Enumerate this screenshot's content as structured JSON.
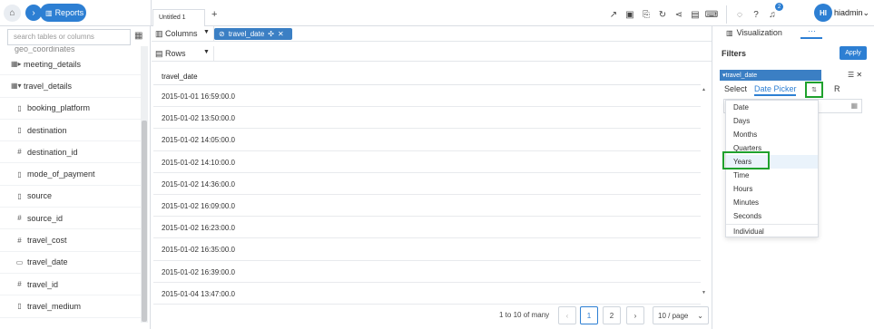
{
  "topbar": {
    "reports_label": "Reports",
    "tab_title": "Untitled 1",
    "tab_add": "+",
    "notifications_count": "2",
    "avatar_initials": "HI",
    "username": "hiadmin"
  },
  "sidebar": {
    "search_placeholder": "search tables or columns",
    "items": [
      {
        "label": "meeting_details",
        "type": "table"
      },
      {
        "label": "travel_details",
        "type": "table"
      },
      {
        "label": "booking_platform",
        "type": "text"
      },
      {
        "label": "destination",
        "type": "text"
      },
      {
        "label": "destination_id",
        "type": "number"
      },
      {
        "label": "mode_of_payment",
        "type": "text"
      },
      {
        "label": "source",
        "type": "text"
      },
      {
        "label": "source_id",
        "type": "number"
      },
      {
        "label": "travel_cost",
        "type": "number"
      },
      {
        "label": "travel_date",
        "type": "date"
      },
      {
        "label": "travel_id",
        "type": "number"
      },
      {
        "label": "travel_medium",
        "type": "text"
      }
    ]
  },
  "shelves": {
    "columns_label": "Columns",
    "rows_label": "Rows",
    "column_chip": "travel_date"
  },
  "grid": {
    "header": "travel_date",
    "rows": [
      "2015-01-01 16:59:00.0",
      "2015-01-02 13:50:00.0",
      "2015-01-02 14:05:00.0",
      "2015-01-02 14:10:00.0",
      "2015-01-02 14:36:00.0",
      "2015-01-02 16:09:00.0",
      "2015-01-02 16:23:00.0",
      "2015-01-02 16:35:00.0",
      "2015-01-02 16:39:00.0",
      "2015-01-04 13:47:00.0"
    ]
  },
  "pagination": {
    "summary": "1 to 10 of many",
    "page_1": "1",
    "page_2": "2",
    "page_size": "10 / page"
  },
  "right_panel": {
    "visualization_tab": "Visualization",
    "more_tab": "···",
    "filters_title": "Filters",
    "apply_label": "Apply",
    "filter_field": "travel_date",
    "filter_tabs": {
      "select": "Select",
      "date_picker": "Date Picker",
      "r": "R"
    }
  },
  "menu": {
    "items": [
      "Date",
      "Days",
      "Months",
      "Quarters",
      "Years",
      "Time",
      "Hours",
      "Minutes",
      "Seconds",
      "Individual"
    ],
    "selected": "Years"
  },
  "colors": {
    "accent": "#2d7fd3",
    "highlight_box": "#1fa12d",
    "chip": "#3b7fc4"
  }
}
